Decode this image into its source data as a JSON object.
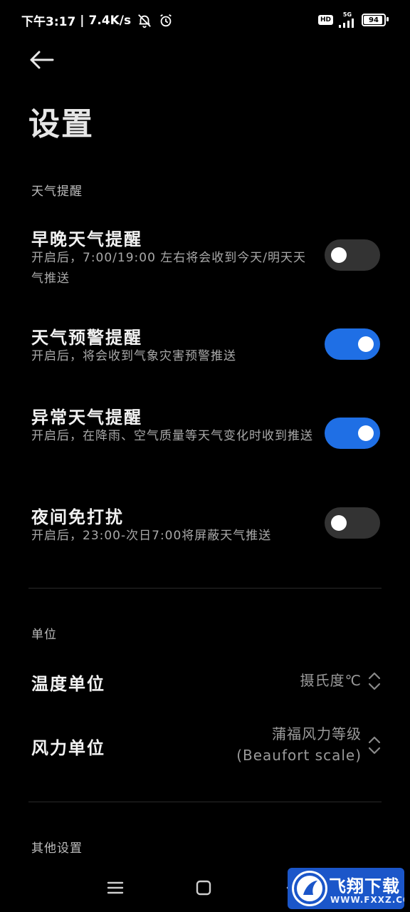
{
  "status_bar": {
    "time": "下午3:17",
    "net_speed": "7.4K/s",
    "hd": "HD",
    "network": "5G",
    "battery": "94",
    "battery_level": 0.94
  },
  "header": {
    "title": "设置"
  },
  "sections": {
    "weather_alerts": {
      "label": "天气提醒",
      "items": [
        {
          "title": "早晚天气提醒",
          "desc": "开启后，7:00/19:00 左右将会收到今天/明天天气推送",
          "enabled": false
        },
        {
          "title": "天气预警提醒",
          "desc": "开启后，将会收到气象灾害预警推送",
          "enabled": true
        },
        {
          "title": "异常天气提醒",
          "desc": "开启后，在降雨、空气质量等天气变化时收到推送",
          "enabled": true
        },
        {
          "title": "夜间免打扰",
          "desc": "开启后，23:00-次日7:00将屏蔽天气推送",
          "enabled": false
        }
      ]
    },
    "units": {
      "label": "单位",
      "items": [
        {
          "title": "温度单位",
          "value": "摄氏度℃"
        },
        {
          "title": "风力单位",
          "value_line1": "蒲福风力等级",
          "value_line2": "(Beaufort scale)"
        }
      ]
    },
    "other": {
      "label": "其他设置"
    }
  },
  "watermark": {
    "cn": "飞翔下载",
    "en": "WWW.FXXZ.COM"
  },
  "colors": {
    "toggle_on": "#1f6fe5",
    "toggle_off": "#333333",
    "background": "#000000"
  }
}
